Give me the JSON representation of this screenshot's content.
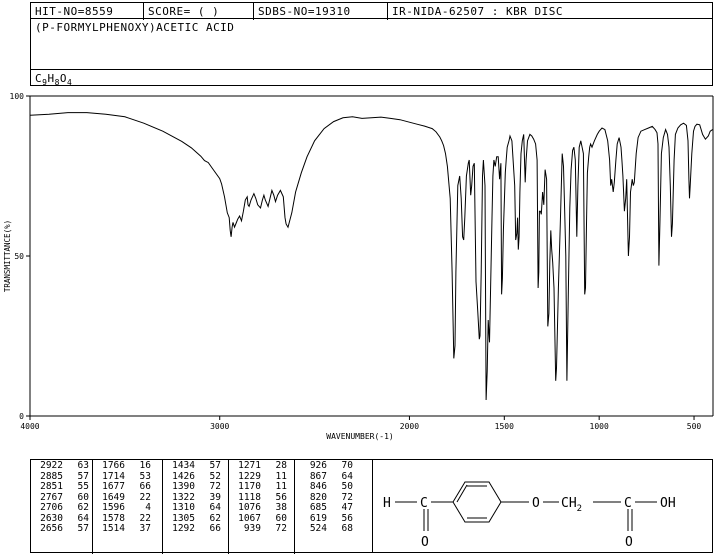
{
  "header": {
    "hit": "HIT-NO=8559",
    "score": "SCORE=  (   )",
    "sdbs": "SDBS-NO=19310",
    "ir": "IR-NIDA-62507 : KBR DISC"
  },
  "compound_name": "(P-FORMYLPHENOXY)ACETIC ACID",
  "formula": {
    "c": "C",
    "c_n": "9",
    "h": "H",
    "h_n": "8",
    "o": "O",
    "o_n": "4"
  },
  "chart_data": {
    "type": "line",
    "xlabel": "WAVENUMBER(-1)",
    "ylabel": "TRANSMITTANCE(%)",
    "xlim": [
      4000,
      400
    ],
    "ylim": [
      0,
      100
    ],
    "xticks": [
      4000,
      3000,
      2000,
      1500,
      1000,
      500
    ],
    "yticks": [
      100,
      50,
      0
    ],
    "series": [
      {
        "points": [
          [
            3999,
            94
          ],
          [
            3900,
            94.3
          ],
          [
            3800,
            94.8
          ],
          [
            3700,
            94.8
          ],
          [
            3600,
            94.3
          ],
          [
            3500,
            93.5
          ],
          [
            3400,
            91.5
          ],
          [
            3300,
            89
          ],
          [
            3200,
            85.8
          ],
          [
            3150,
            83.8
          ],
          [
            3100,
            81.2
          ],
          [
            3080,
            79.8
          ],
          [
            3060,
            79.2
          ],
          [
            3040,
            77.5
          ],
          [
            3000,
            74.2
          ],
          [
            2990,
            72.5
          ],
          [
            2975,
            68.5
          ],
          [
            2960,
            63.5
          ],
          [
            2950,
            62
          ],
          [
            2945,
            58
          ],
          [
            2940,
            56
          ],
          [
            2935,
            59
          ],
          [
            2930,
            60.5
          ],
          [
            2922,
            59
          ],
          [
            2915,
            60
          ],
          [
            2905,
            61.5
          ],
          [
            2895,
            62.5
          ],
          [
            2885,
            61
          ],
          [
            2875,
            64
          ],
          [
            2865,
            67.5
          ],
          [
            2855,
            68.5
          ],
          [
            2851,
            66
          ],
          [
            2845,
            65.5
          ],
          [
            2835,
            67.5
          ],
          [
            2820,
            69.5
          ],
          [
            2810,
            68
          ],
          [
            2800,
            66
          ],
          [
            2785,
            65
          ],
          [
            2775,
            67.5
          ],
          [
            2767,
            69
          ],
          [
            2760,
            67.5
          ],
          [
            2745,
            65.5
          ],
          [
            2735,
            68
          ],
          [
            2725,
            70.5
          ],
          [
            2715,
            69
          ],
          [
            2706,
            67
          ],
          [
            2695,
            69
          ],
          [
            2680,
            70.5
          ],
          [
            2665,
            68.5
          ],
          [
            2656,
            62
          ],
          [
            2650,
            60
          ],
          [
            2640,
            59
          ],
          [
            2620,
            63.5
          ],
          [
            2600,
            70
          ],
          [
            2570,
            76
          ],
          [
            2540,
            81
          ],
          [
            2500,
            86
          ],
          [
            2450,
            89.8
          ],
          [
            2400,
            92
          ],
          [
            2350,
            93.2
          ],
          [
            2300,
            93.5
          ],
          [
            2250,
            93
          ],
          [
            2200,
            93.2
          ],
          [
            2150,
            93.4
          ],
          [
            2100,
            93
          ],
          [
            2050,
            92.6
          ],
          [
            2000,
            91.8
          ],
          [
            1960,
            91.2
          ],
          [
            1920,
            90.6
          ],
          [
            1900,
            90.2
          ],
          [
            1880,
            89.8
          ],
          [
            1860,
            88.8
          ],
          [
            1840,
            87.2
          ],
          [
            1830,
            86
          ],
          [
            1820,
            84.5
          ],
          [
            1810,
            82
          ],
          [
            1800,
            78
          ],
          [
            1785,
            68
          ],
          [
            1775,
            45
          ],
          [
            1766,
            18
          ],
          [
            1760,
            22
          ],
          [
            1755,
            45
          ],
          [
            1745,
            72
          ],
          [
            1735,
            75
          ],
          [
            1727,
            68
          ],
          [
            1720,
            56
          ],
          [
            1714,
            55
          ],
          [
            1708,
            62
          ],
          [
            1700,
            75
          ],
          [
            1690,
            79
          ],
          [
            1685,
            80
          ],
          [
            1677,
            69
          ],
          [
            1672,
            72
          ],
          [
            1665,
            78
          ],
          [
            1658,
            79
          ],
          [
            1649,
            42
          ],
          [
            1640,
            33
          ],
          [
            1632,
            24
          ],
          [
            1628,
            25
          ],
          [
            1622,
            45
          ],
          [
            1615,
            75
          ],
          [
            1610,
            80
          ],
          [
            1602,
            72
          ],
          [
            1596,
            5
          ],
          [
            1590,
            14
          ],
          [
            1585,
            30
          ],
          [
            1578,
            23
          ],
          [
            1572,
            40
          ],
          [
            1565,
            62
          ],
          [
            1560,
            75
          ],
          [
            1555,
            80
          ],
          [
            1548,
            78
          ],
          [
            1540,
            81
          ],
          [
            1532,
            81
          ],
          [
            1525,
            74
          ],
          [
            1518,
            79
          ],
          [
            1514,
            38
          ],
          [
            1510,
            43
          ],
          [
            1505,
            58
          ],
          [
            1495,
            76
          ],
          [
            1490,
            80
          ],
          [
            1485,
            84
          ],
          [
            1475,
            86
          ],
          [
            1470,
            87.5
          ],
          [
            1460,
            86
          ],
          [
            1445,
            72
          ],
          [
            1440,
            55
          ],
          [
            1434,
            57
          ],
          [
            1430,
            62
          ],
          [
            1426,
            52
          ],
          [
            1422,
            56
          ],
          [
            1418,
            70
          ],
          [
            1412,
            82
          ],
          [
            1405,
            86
          ],
          [
            1398,
            88
          ],
          [
            1390,
            73
          ],
          [
            1385,
            80
          ],
          [
            1378,
            86
          ],
          [
            1365,
            88
          ],
          [
            1355,
            87.5
          ],
          [
            1345,
            86.5
          ],
          [
            1335,
            85
          ],
          [
            1327,
            80
          ],
          [
            1322,
            40
          ],
          [
            1318,
            45
          ],
          [
            1315,
            64
          ],
          [
            1310,
            64
          ],
          [
            1305,
            63
          ],
          [
            1298,
            70
          ],
          [
            1292,
            66
          ],
          [
            1285,
            77
          ],
          [
            1277,
            74
          ],
          [
            1271,
            28
          ],
          [
            1265,
            32
          ],
          [
            1260,
            48
          ],
          [
            1255,
            58
          ],
          [
            1250,
            52
          ],
          [
            1245,
            48
          ],
          [
            1238,
            40
          ],
          [
            1229,
            11
          ],
          [
            1225,
            15
          ],
          [
            1215,
            40
          ],
          [
            1205,
            60
          ],
          [
            1195,
            82
          ],
          [
            1188,
            78
          ],
          [
            1182,
            65
          ],
          [
            1176,
            50
          ],
          [
            1170,
            11
          ],
          [
            1162,
            40
          ],
          [
            1155,
            65
          ],
          [
            1148,
            77
          ],
          [
            1140,
            83
          ],
          [
            1133,
            84
          ],
          [
            1126,
            80
          ],
          [
            1118,
            56
          ],
          [
            1112,
            72
          ],
          [
            1105,
            84
          ],
          [
            1097,
            86
          ],
          [
            1090,
            84
          ],
          [
            1083,
            82
          ],
          [
            1076,
            38
          ],
          [
            1072,
            40
          ],
          [
            1067,
            60
          ],
          [
            1062,
            76
          ],
          [
            1055,
            81
          ],
          [
            1050,
            84
          ],
          [
            1045,
            85
          ],
          [
            1038,
            84
          ],
          [
            1025,
            86
          ],
          [
            1010,
            88
          ],
          [
            1000,
            89
          ],
          [
            985,
            90
          ],
          [
            970,
            89.5
          ],
          [
            955,
            86
          ],
          [
            945,
            80
          ],
          [
            939,
            72
          ],
          [
            934,
            74
          ],
          [
            926,
            70
          ],
          [
            920,
            73
          ],
          [
            912,
            80
          ],
          [
            905,
            85
          ],
          [
            895,
            87
          ],
          [
            885,
            84
          ],
          [
            880,
            80
          ],
          [
            875,
            75
          ],
          [
            867,
            64
          ],
          [
            860,
            68
          ],
          [
            855,
            74
          ],
          [
            846,
            50
          ],
          [
            840,
            56
          ],
          [
            835,
            70
          ],
          [
            830,
            72
          ],
          [
            826,
            74
          ],
          [
            820,
            72
          ],
          [
            815,
            73
          ],
          [
            805,
            82
          ],
          [
            795,
            87
          ],
          [
            780,
            89
          ],
          [
            760,
            89.5
          ],
          [
            740,
            90
          ],
          [
            720,
            90.5
          ],
          [
            705,
            89.5
          ],
          [
            695,
            88.5
          ],
          [
            690,
            85
          ],
          [
            685,
            47
          ],
          [
            680,
            60
          ],
          [
            672,
            82
          ],
          [
            662,
            87
          ],
          [
            650,
            89.5
          ],
          [
            640,
            88
          ],
          [
            632,
            84
          ],
          [
            625,
            72
          ],
          [
            619,
            56
          ],
          [
            614,
            60
          ],
          [
            605,
            80
          ],
          [
            598,
            88
          ],
          [
            585,
            90
          ],
          [
            570,
            91
          ],
          [
            555,
            91.5
          ],
          [
            540,
            90.8
          ],
          [
            532,
            86
          ],
          [
            527,
            74
          ],
          [
            524,
            68
          ],
          [
            520,
            72
          ],
          [
            512,
            82
          ],
          [
            503,
            89
          ],
          [
            495,
            90.5
          ],
          [
            485,
            91.2
          ],
          [
            470,
            91
          ],
          [
            455,
            88
          ],
          [
            440,
            86.5
          ],
          [
            425,
            87.5
          ],
          [
            415,
            89
          ],
          [
            402,
            89.5
          ]
        ]
      }
    ]
  },
  "peaks": [
    [
      [
        "2922",
        "63"
      ],
      [
        "2885",
        "57"
      ],
      [
        "2851",
        "55"
      ],
      [
        "2767",
        "60"
      ],
      [
        "2706",
        "62"
      ],
      [
        "2630",
        "64"
      ],
      [
        "2656",
        "57"
      ]
    ],
    [
      [
        "1766",
        "16"
      ],
      [
        "1714",
        "53"
      ],
      [
        "1677",
        "66"
      ],
      [
        "1649",
        "22"
      ],
      [
        "1596",
        "4"
      ],
      [
        "1578",
        "22"
      ],
      [
        "1514",
        "37"
      ]
    ],
    [
      [
        "1434",
        "57"
      ],
      [
        "1426",
        "52"
      ],
      [
        "1390",
        "72"
      ],
      [
        "1322",
        "39"
      ],
      [
        "1310",
        "64"
      ],
      [
        "1305",
        "62"
      ],
      [
        "1292",
        "66"
      ]
    ],
    [
      [
        "1271",
        "28"
      ],
      [
        "1229",
        "11"
      ],
      [
        "1170",
        "11"
      ],
      [
        "1118",
        "56"
      ],
      [
        "1076",
        "38"
      ],
      [
        "1067",
        "60"
      ],
      [
        "939",
        "72"
      ]
    ],
    [
      [
        "926",
        "70"
      ],
      [
        "867",
        "64"
      ],
      [
        "846",
        "50"
      ],
      [
        "820",
        "72"
      ],
      [
        "685",
        "47"
      ],
      [
        "619",
        "56"
      ],
      [
        "524",
        "68"
      ]
    ]
  ],
  "structure": {
    "h_label": "H",
    "c_label": "C",
    "o_ald": "O",
    "o_ether": "O",
    "ch2_label": "CH",
    "ch2_sub": "2",
    "c_acid": "C",
    "oh_label": "OH",
    "o_acid": "O"
  }
}
